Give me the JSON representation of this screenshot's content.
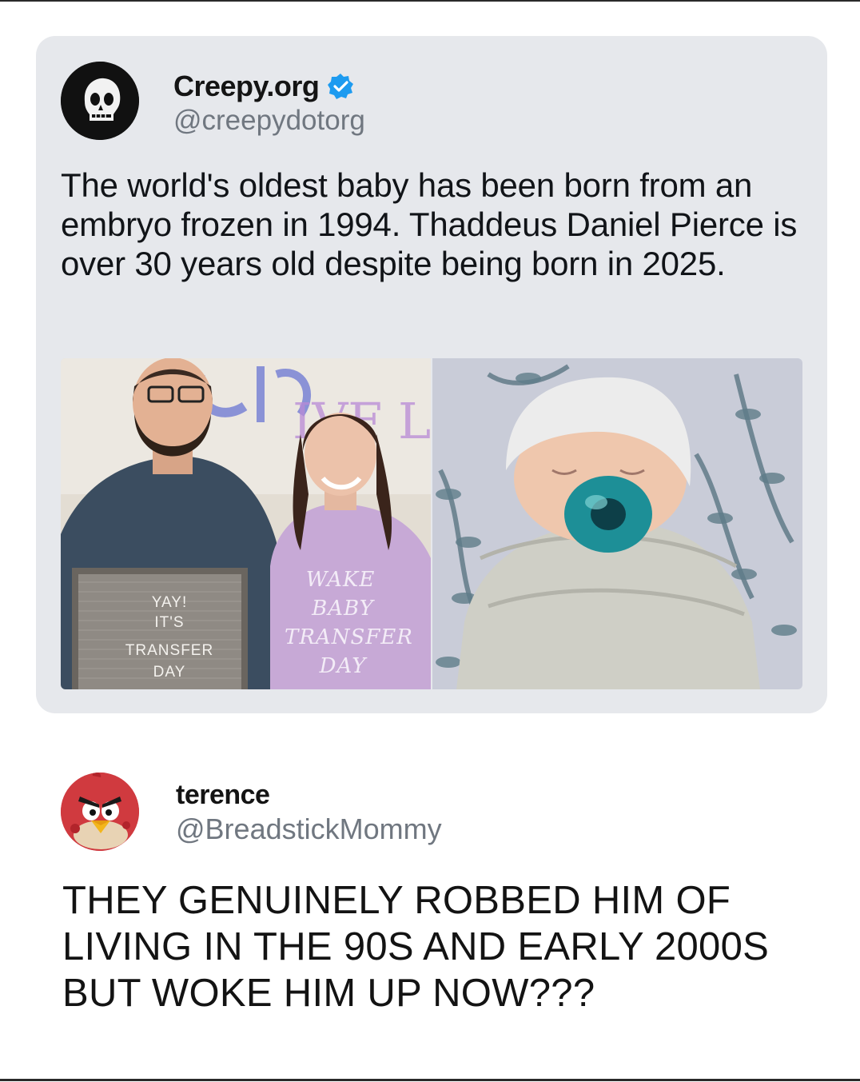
{
  "quoted_post": {
    "display_name": "Creepy.org",
    "verified_icon": "verified-badge-icon",
    "handle": "@creepydotorg",
    "avatar_icon": "skull-icon",
    "text": "The world's oldest baby has been born from an embryo frozen in 1994. Thaddeus Daniel Pierce is over 30 years old despite being born in 2025.",
    "media": {
      "left_photo": {
        "sign_lines": [
          "YAY!",
          "IT'S",
          "TRANSFER",
          "DAY"
        ],
        "shirt_lines": [
          "WAKE",
          "BABY",
          "TRANSFER",
          "DAY"
        ]
      },
      "right_photo": {}
    }
  },
  "reply_post": {
    "display_name": "terence",
    "handle": "@BreadstickMommy",
    "avatar_icon": "angry-red-bird-icon",
    "text": "THEY GENUINELY ROBBED HIM OF LIVING IN THE 90S AND EARLY 2000S BUT WOKE HIM UP NOW???"
  },
  "colors": {
    "card_background": "#e6e8ec",
    "verified_blue": "#1d9bf0",
    "handle_gray": "#707780"
  }
}
